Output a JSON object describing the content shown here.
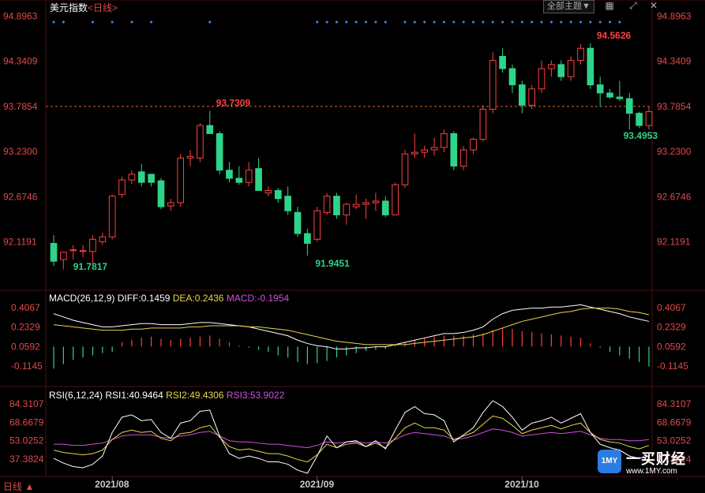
{
  "header": {
    "title": "美元指数",
    "period": "<日线>",
    "theme_button": "全部主题▼",
    "icons": [
      "grid-icon",
      "expand-icon",
      "close-icon"
    ]
  },
  "colors": {
    "up": "#ff4040",
    "down": "#2fd38a",
    "axis_text": "#e04a4a",
    "white_line": "#ffffff",
    "yellow_line": "#e8d64a",
    "magenta_line": "#d050e0",
    "grid": "#333333",
    "dashed": "#d06a2a"
  },
  "price_panel": {
    "y_ticks": [
      "94.8963",
      "94.3409",
      "93.7854",
      "93.2300",
      "92.6746",
      "92.1191"
    ],
    "y_min": 91.6,
    "y_max": 94.9,
    "reference_line": "93.7854",
    "annotations": [
      {
        "label": "91.7817",
        "color": "down"
      },
      {
        "label": "93.7309",
        "color": "up"
      },
      {
        "label": "91.9451",
        "color": "down"
      },
      {
        "label": "94.5626",
        "color": "up"
      },
      {
        "label": "93.4953",
        "color": "down"
      }
    ]
  },
  "macd_panel": {
    "label": "MACD(26,12,9)",
    "diff_label": "DIFF:0.1459",
    "dea_label": "DEA:0.2436",
    "macd_label": "MACD:-0.1954",
    "y_ticks": [
      "0.4067",
      "0.2329",
      "0.0592",
      "-0.1145"
    ]
  },
  "rsi_panel": {
    "label": "RSI(6,12,24)",
    "rsi1_label": "RSI1:40.9464",
    "rsi2_label": "RSI2:49.4306",
    "rsi3_label": "RSI3:53.9022",
    "y_ticks": [
      "84.3107",
      "68.6679",
      "53.0252",
      "37.3824"
    ]
  },
  "x_axis": {
    "period_label": "日线 ▲",
    "dates": [
      "2021/08",
      "2021/09",
      "2021/10"
    ]
  },
  "logo": {
    "text": "一买财经",
    "url": "www.1MY.com",
    "badge": "1MY"
  },
  "chart_data": [
    {
      "type": "candlestick",
      "title": "美元指数",
      "ylim": [
        91.6,
        94.9
      ],
      "candles": [
        {
          "o": 92.1,
          "h": 92.2,
          "l": 91.82,
          "c": 91.88
        },
        {
          "o": 91.9,
          "h": 92.0,
          "l": 91.78,
          "c": 91.99
        },
        {
          "o": 92.02,
          "h": 92.08,
          "l": 91.9,
          "c": 92.02
        },
        {
          "o": 92.0,
          "h": 92.08,
          "l": 91.93,
          "c": 92.01
        },
        {
          "o": 92.0,
          "h": 92.2,
          "l": 91.85,
          "c": 92.15
        },
        {
          "o": 92.12,
          "h": 92.23,
          "l": 92.08,
          "c": 92.18
        },
        {
          "o": 92.18,
          "h": 92.7,
          "l": 92.15,
          "c": 92.68
        },
        {
          "o": 92.7,
          "h": 92.92,
          "l": 92.66,
          "c": 92.88
        },
        {
          "o": 92.88,
          "h": 93.0,
          "l": 92.83,
          "c": 92.95
        },
        {
          "o": 92.98,
          "h": 93.08,
          "l": 92.8,
          "c": 92.85
        },
        {
          "o": 92.95,
          "h": 92.95,
          "l": 92.8,
          "c": 92.85
        },
        {
          "o": 92.87,
          "h": 92.9,
          "l": 92.52,
          "c": 92.55
        },
        {
          "o": 92.56,
          "h": 92.65,
          "l": 92.5,
          "c": 92.6
        },
        {
          "o": 92.6,
          "h": 93.2,
          "l": 92.55,
          "c": 93.15
        },
        {
          "o": 93.15,
          "h": 93.25,
          "l": 93.05,
          "c": 93.17
        },
        {
          "o": 93.15,
          "h": 93.58,
          "l": 93.1,
          "c": 93.55
        },
        {
          "o": 93.55,
          "h": 93.73,
          "l": 93.48,
          "c": 93.45
        },
        {
          "o": 93.45,
          "h": 93.48,
          "l": 92.95,
          "c": 93.0
        },
        {
          "o": 93.0,
          "h": 93.1,
          "l": 92.85,
          "c": 92.9
        },
        {
          "o": 92.9,
          "h": 93.05,
          "l": 92.82,
          "c": 92.85
        },
        {
          "o": 92.85,
          "h": 93.1,
          "l": 92.8,
          "c": 93.0
        },
        {
          "o": 93.02,
          "h": 93.15,
          "l": 92.8,
          "c": 92.75
        },
        {
          "o": 92.72,
          "h": 92.8,
          "l": 92.68,
          "c": 92.75
        },
        {
          "o": 92.75,
          "h": 92.78,
          "l": 92.6,
          "c": 92.65
        },
        {
          "o": 92.68,
          "h": 92.8,
          "l": 92.45,
          "c": 92.5
        },
        {
          "o": 92.48,
          "h": 92.55,
          "l": 92.18,
          "c": 92.22
        },
        {
          "o": 92.22,
          "h": 92.28,
          "l": 91.95,
          "c": 92.1
        },
        {
          "o": 92.15,
          "h": 92.55,
          "l": 92.12,
          "c": 92.5
        },
        {
          "o": 92.48,
          "h": 92.72,
          "l": 92.45,
          "c": 92.68
        },
        {
          "o": 92.68,
          "h": 92.72,
          "l": 92.4,
          "c": 92.45
        },
        {
          "o": 92.45,
          "h": 92.6,
          "l": 92.33,
          "c": 92.58
        },
        {
          "o": 92.55,
          "h": 92.7,
          "l": 92.52,
          "c": 92.58
        },
        {
          "o": 92.58,
          "h": 92.65,
          "l": 92.4,
          "c": 92.6
        },
        {
          "o": 92.6,
          "h": 92.72,
          "l": 92.5,
          "c": 92.62
        },
        {
          "o": 92.62,
          "h": 92.68,
          "l": 92.42,
          "c": 92.45
        },
        {
          "o": 92.45,
          "h": 92.85,
          "l": 92.45,
          "c": 92.82
        },
        {
          "o": 92.82,
          "h": 93.25,
          "l": 92.78,
          "c": 93.2
        },
        {
          "o": 93.2,
          "h": 93.45,
          "l": 93.15,
          "c": 93.22
        },
        {
          "o": 93.22,
          "h": 93.3,
          "l": 93.15,
          "c": 93.25
        },
        {
          "o": 93.25,
          "h": 93.4,
          "l": 93.18,
          "c": 93.28
        },
        {
          "o": 93.28,
          "h": 93.5,
          "l": 93.22,
          "c": 93.45
        },
        {
          "o": 93.45,
          "h": 93.48,
          "l": 93.0,
          "c": 93.05
        },
        {
          "o": 93.05,
          "h": 93.3,
          "l": 93.0,
          "c": 93.25
        },
        {
          "o": 93.25,
          "h": 93.4,
          "l": 93.2,
          "c": 93.38
        },
        {
          "o": 93.38,
          "h": 93.8,
          "l": 93.35,
          "c": 93.75
        },
        {
          "o": 93.75,
          "h": 94.45,
          "l": 93.7,
          "c": 94.35
        },
        {
          "o": 94.4,
          "h": 94.5,
          "l": 94.2,
          "c": 94.25
        },
        {
          "o": 94.25,
          "h": 94.3,
          "l": 93.95,
          "c": 94.05
        },
        {
          "o": 94.05,
          "h": 94.1,
          "l": 93.7,
          "c": 93.8
        },
        {
          "o": 93.8,
          "h": 94.05,
          "l": 93.75,
          "c": 94.0
        },
        {
          "o": 94.0,
          "h": 94.35,
          "l": 93.95,
          "c": 94.25
        },
        {
          "o": 94.25,
          "h": 94.35,
          "l": 94.15,
          "c": 94.3
        },
        {
          "o": 94.3,
          "h": 94.35,
          "l": 94.1,
          "c": 94.15
        },
        {
          "o": 94.15,
          "h": 94.4,
          "l": 94.1,
          "c": 94.35
        },
        {
          "o": 94.35,
          "h": 94.55,
          "l": 94.3,
          "c": 94.5
        },
        {
          "o": 94.5,
          "h": 94.56,
          "l": 94.0,
          "c": 94.05
        },
        {
          "o": 94.05,
          "h": 94.15,
          "l": 93.78,
          "c": 93.95
        },
        {
          "o": 93.95,
          "h": 94.0,
          "l": 93.88,
          "c": 93.9
        },
        {
          "o": 93.9,
          "h": 94.1,
          "l": 93.85,
          "c": 93.88
        },
        {
          "o": 93.88,
          "h": 93.95,
          "l": 93.5,
          "c": 93.7
        },
        {
          "o": 93.7,
          "h": 93.72,
          "l": 93.52,
          "c": 93.55
        },
        {
          "o": 93.55,
          "h": 93.78,
          "l": 93.5,
          "c": 93.72
        }
      ],
      "series": [
        {
          "name": "DIFF",
          "values": [
            0.3,
            0.27,
            0.24,
            0.22,
            0.2,
            0.18,
            0.18,
            0.19,
            0.2,
            0.21,
            0.21,
            0.2,
            0.2,
            0.2,
            0.21,
            0.22,
            0.22,
            0.21,
            0.2,
            0.19,
            0.18,
            0.16,
            0.14,
            0.12,
            0.1,
            0.06,
            0.03,
            0.01,
            0.0,
            -0.02,
            -0.02,
            -0.01,
            -0.01,
            0.0,
            0.0,
            0.02,
            0.04,
            0.06,
            0.08,
            0.1,
            0.12,
            0.12,
            0.13,
            0.15,
            0.18,
            0.25,
            0.3,
            0.33,
            0.34,
            0.35,
            0.35,
            0.36,
            0.36,
            0.37,
            0.38,
            0.36,
            0.34,
            0.32,
            0.3,
            0.27,
            0.25,
            0.23
          ]
        },
        {
          "name": "DEA",
          "values": [
            0.2,
            0.19,
            0.18,
            0.17,
            0.16,
            0.15,
            0.15,
            0.15,
            0.16,
            0.16,
            0.17,
            0.17,
            0.17,
            0.17,
            0.18,
            0.18,
            0.19,
            0.19,
            0.19,
            0.19,
            0.18,
            0.18,
            0.17,
            0.16,
            0.15,
            0.13,
            0.11,
            0.09,
            0.07,
            0.05,
            0.04,
            0.03,
            0.02,
            0.02,
            0.02,
            0.02,
            0.02,
            0.03,
            0.04,
            0.05,
            0.06,
            0.07,
            0.08,
            0.09,
            0.11,
            0.14,
            0.17,
            0.2,
            0.23,
            0.25,
            0.27,
            0.29,
            0.31,
            0.32,
            0.34,
            0.35,
            0.35,
            0.35,
            0.34,
            0.32,
            0.31,
            0.29
          ]
        },
        {
          "name": "MACD",
          "values": [
            -0.2,
            -0.16,
            -0.12,
            -0.1,
            -0.08,
            -0.06,
            -0.05,
            0.04,
            0.06,
            0.08,
            0.09,
            0.07,
            0.06,
            0.07,
            0.08,
            0.09,
            0.1,
            0.07,
            0.04,
            0.01,
            -0.01,
            -0.03,
            -0.05,
            -0.08,
            -0.1,
            -0.14,
            -0.16,
            -0.15,
            -0.13,
            -0.1,
            -0.08,
            -0.06,
            -0.04,
            -0.03,
            -0.02,
            0.02,
            0.04,
            0.06,
            0.08,
            0.09,
            0.1,
            0.1,
            0.1,
            0.11,
            0.12,
            0.15,
            0.17,
            0.16,
            0.14,
            0.13,
            0.12,
            0.11,
            0.1,
            0.09,
            0.08,
            0.03,
            -0.01,
            -0.05,
            -0.08,
            -0.11,
            -0.14,
            -0.18
          ]
        }
      ],
      "rsi": [
        {
          "name": "RSI1",
          "values": [
            38,
            34,
            31,
            30,
            33,
            40,
            60,
            73,
            75,
            70,
            71,
            60,
            55,
            68,
            70,
            78,
            79,
            57,
            42,
            38,
            40,
            38,
            35,
            35,
            33,
            28,
            25,
            40,
            57,
            47,
            52,
            53,
            48,
            53,
            46,
            62,
            77,
            82,
            76,
            75,
            70,
            52,
            58,
            64,
            77,
            87,
            82,
            73,
            62,
            68,
            70,
            73,
            68,
            72,
            76,
            60,
            50,
            47,
            45,
            40,
            38,
            40
          ]
        },
        {
          "name": "RSI2",
          "values": [
            45,
            43,
            42,
            41,
            42,
            45,
            54,
            60,
            62,
            60,
            61,
            55,
            53,
            59,
            60,
            64,
            66,
            56,
            48,
            45,
            46,
            44,
            42,
            42,
            40,
            37,
            35,
            41,
            50,
            47,
            50,
            51,
            48,
            51,
            47,
            55,
            64,
            68,
            64,
            64,
            62,
            54,
            57,
            60,
            67,
            74,
            72,
            66,
            59,
            62,
            64,
            66,
            63,
            66,
            68,
            60,
            54,
            52,
            51,
            48,
            46,
            49
          ]
        },
        {
          "name": "RSI3",
          "values": [
            50,
            50,
            49,
            49,
            50,
            51,
            54,
            57,
            58,
            58,
            58,
            56,
            55,
            57,
            58,
            60,
            61,
            57,
            53,
            52,
            52,
            51,
            50,
            50,
            49,
            48,
            47,
            49,
            52,
            51,
            52,
            52,
            51,
            52,
            51,
            54,
            58,
            60,
            59,
            58,
            57,
            54,
            55,
            57,
            60,
            63,
            62,
            60,
            57,
            58,
            59,
            60,
            59,
            60,
            61,
            58,
            55,
            54,
            54,
            53,
            53,
            54
          ]
        }
      ]
    }
  ]
}
